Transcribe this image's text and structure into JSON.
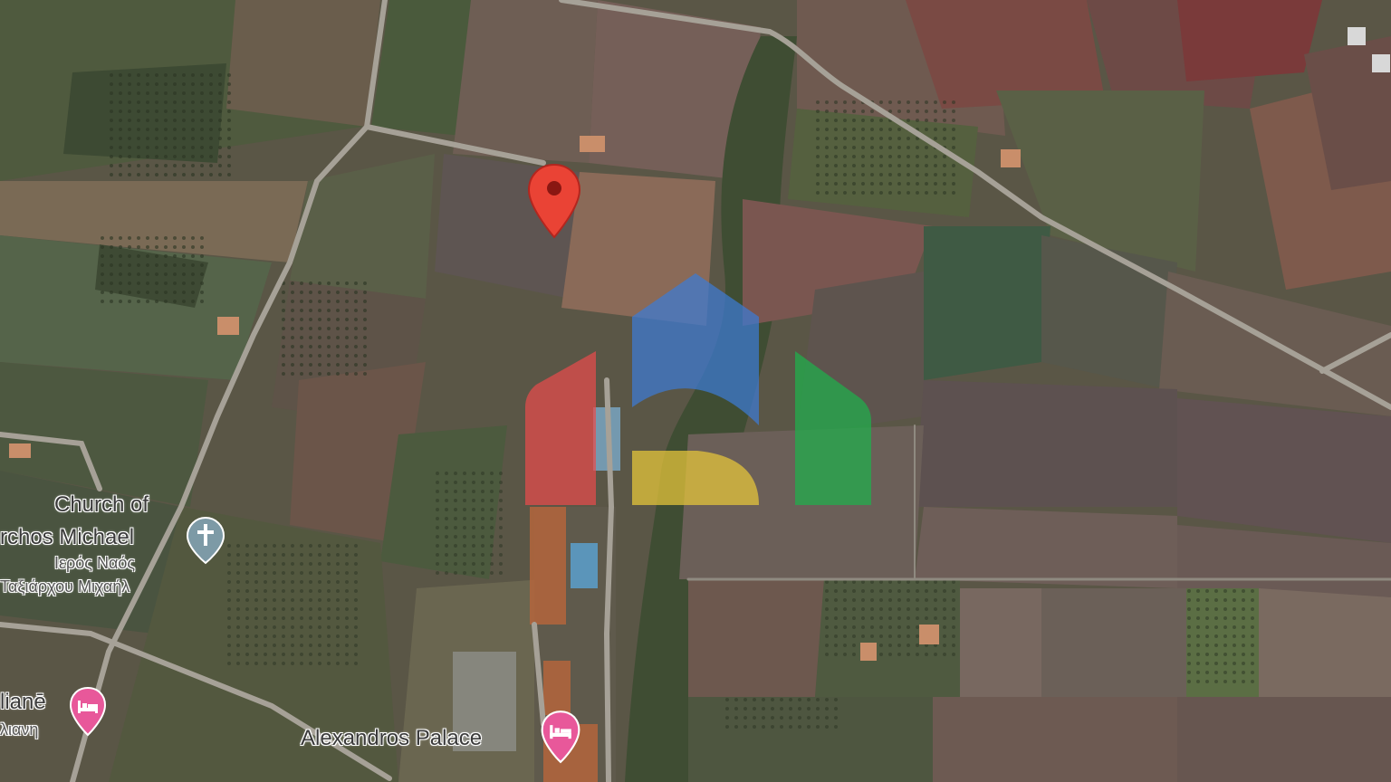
{
  "map": {
    "type": "satellite",
    "pin_color": "#ea4335"
  },
  "places": {
    "church": {
      "name_line1": "Church of",
      "name_line2": "rchos Michael",
      "local_line1": "Ιερός Ναός",
      "local_line2": "Ταξιάρχου Μιχαήλ",
      "icon": "church-cross-icon"
    },
    "hotel_left": {
      "name_line1": "lianē",
      "name_line2": "λιανη",
      "icon": "hotel-bed-icon"
    },
    "hotel_right": {
      "name": "Alexandros Palace",
      "icon": "hotel-bed-icon"
    }
  },
  "watermark": {
    "colors": [
      "#e74c4c",
      "#3d7bd4",
      "#e8c83a",
      "#1fb04c"
    ]
  }
}
